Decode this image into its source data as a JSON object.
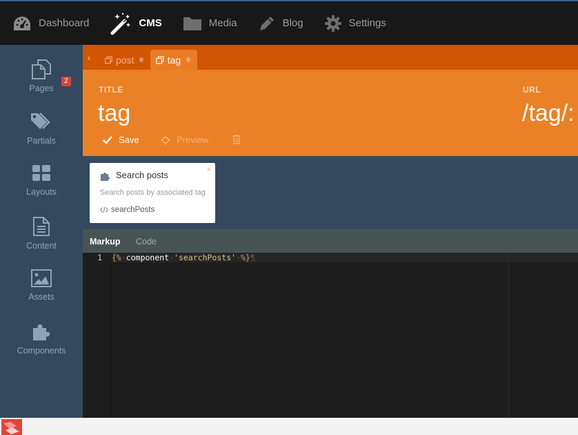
{
  "nav": {
    "items": [
      {
        "label": "Dashboard",
        "icon": "dashboard-icon"
      },
      {
        "label": "CMS",
        "icon": "magic-wand-icon",
        "active": true
      },
      {
        "label": "Media",
        "icon": "folder-icon"
      },
      {
        "label": "Blog",
        "icon": "pencil-icon"
      },
      {
        "label": "Settings",
        "icon": "gear-icon"
      }
    ]
  },
  "sidebar": {
    "items": [
      {
        "label": "Pages",
        "icon": "pages-icon",
        "badge": "2"
      },
      {
        "label": "Partials",
        "icon": "tags-icon"
      },
      {
        "label": "Layouts",
        "icon": "layout-grid-icon"
      },
      {
        "label": "Content",
        "icon": "file-text-icon"
      },
      {
        "label": "Assets",
        "icon": "image-icon"
      },
      {
        "label": "Components",
        "icon": "puzzle-icon"
      }
    ]
  },
  "tabs": [
    {
      "label": "post",
      "icon": "copy-icon",
      "active": false
    },
    {
      "label": "tag",
      "icon": "copy-icon",
      "active": true
    }
  ],
  "form": {
    "title_label": "TITLE",
    "title_value": "tag",
    "url_label": "URL",
    "url_value": "/tag/:"
  },
  "toolbar": {
    "save_label": "Save",
    "preview_label": "Preview"
  },
  "component": {
    "title": "Search posts",
    "description": "Search posts by associated tag",
    "alias": "searchPosts",
    "close": "×"
  },
  "editor_tabs": {
    "markup": "Markup",
    "code": "Code"
  },
  "code": {
    "line_number": "1",
    "open": "{%",
    "keyword": "component",
    "string": "'searchPosts'",
    "close": "%}",
    "eol": "¶"
  },
  "colors": {
    "accent_orange": "#ea8126",
    "tabbar_orange": "#d25504",
    "sidebar_bg": "#34495e",
    "nav_bg": "#181818",
    "badge_red": "#d9443b"
  }
}
